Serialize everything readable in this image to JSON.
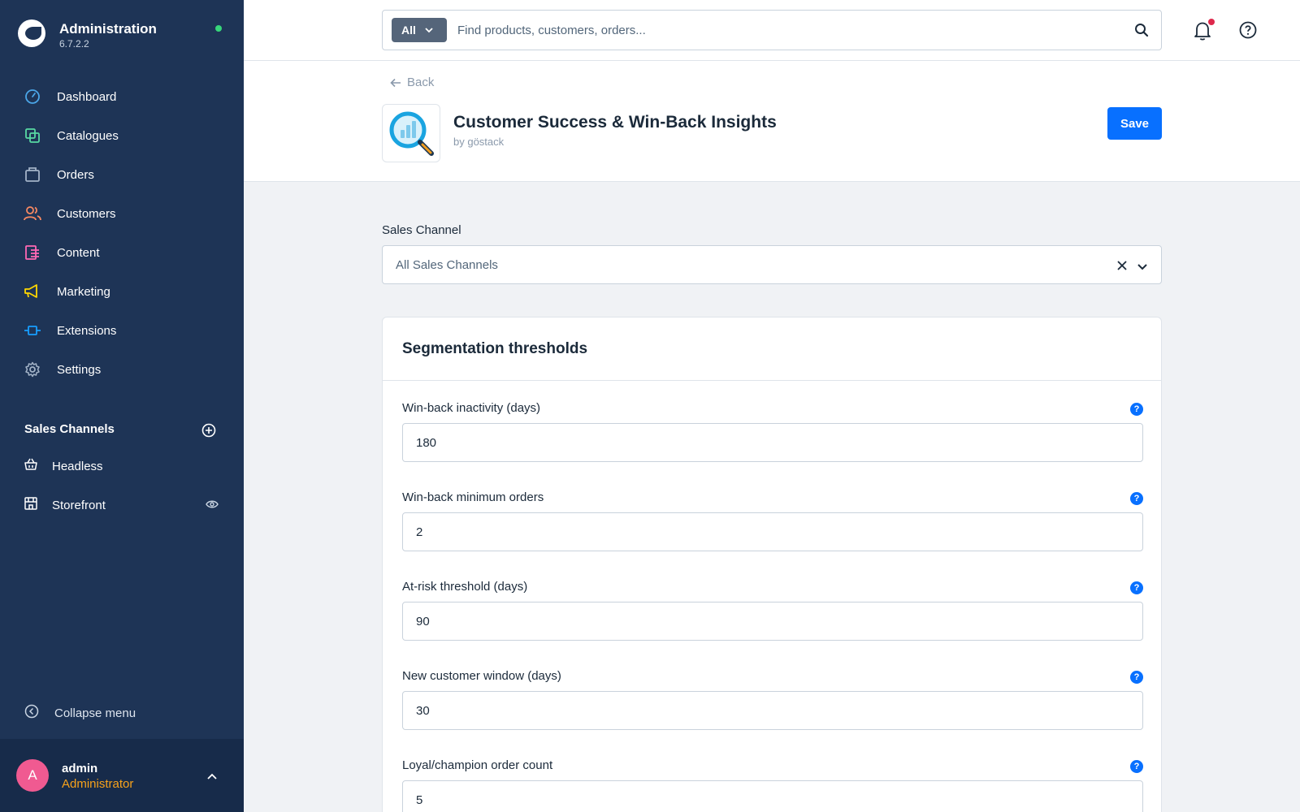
{
  "brand": {
    "title": "Administration",
    "version": "6.7.2.2"
  },
  "nav": [
    {
      "label": "Dashboard",
      "icon": "dashboard-icon",
      "color": "#4ba6e8"
    },
    {
      "label": "Catalogues",
      "icon": "catalogues-icon",
      "color": "#57d9a3"
    },
    {
      "label": "Orders",
      "icon": "orders-icon",
      "color": "#a3b3c7"
    },
    {
      "label": "Customers",
      "icon": "customers-icon",
      "color": "#f88962"
    },
    {
      "label": "Content",
      "icon": "content-icon",
      "color": "#ff68b4"
    },
    {
      "label": "Marketing",
      "icon": "marketing-icon",
      "color": "#ffd700"
    },
    {
      "label": "Extensions",
      "icon": "extensions-icon",
      "color": "#189eff"
    },
    {
      "label": "Settings",
      "icon": "settings-icon",
      "color": "#a3b3c7"
    }
  ],
  "sales_channels": {
    "title": "Sales Channels",
    "items": [
      {
        "label": "Headless",
        "icon": "basket-icon"
      },
      {
        "label": "Storefront",
        "icon": "storefront-icon"
      }
    ]
  },
  "collapse_label": "Collapse menu",
  "user": {
    "initial": "A",
    "name": "admin",
    "role": "Administrator"
  },
  "search": {
    "type_label": "All",
    "placeholder": "Find products, customers, orders..."
  },
  "header": {
    "back_label": "Back",
    "app_title": "Customer Success & Win-Back Insights",
    "app_author": "by göstack",
    "save_label": "Save"
  },
  "sales_channel_select": {
    "label": "Sales Channel",
    "value": "All Sales Channels"
  },
  "card": {
    "title": "Segmentation thresholds",
    "fields": [
      {
        "label": "Win-back inactivity (days)",
        "value": "180"
      },
      {
        "label": "Win-back minimum orders",
        "value": "2"
      },
      {
        "label": "At-risk threshold (days)",
        "value": "90"
      },
      {
        "label": "New customer window (days)",
        "value": "30"
      },
      {
        "label": "Loyal/champion order count",
        "value": "5"
      }
    ]
  },
  "colors": {
    "sidebar": "#1e3456",
    "accent": "#0870ff",
    "role": "#f7a21b",
    "online": "#37d67a"
  }
}
